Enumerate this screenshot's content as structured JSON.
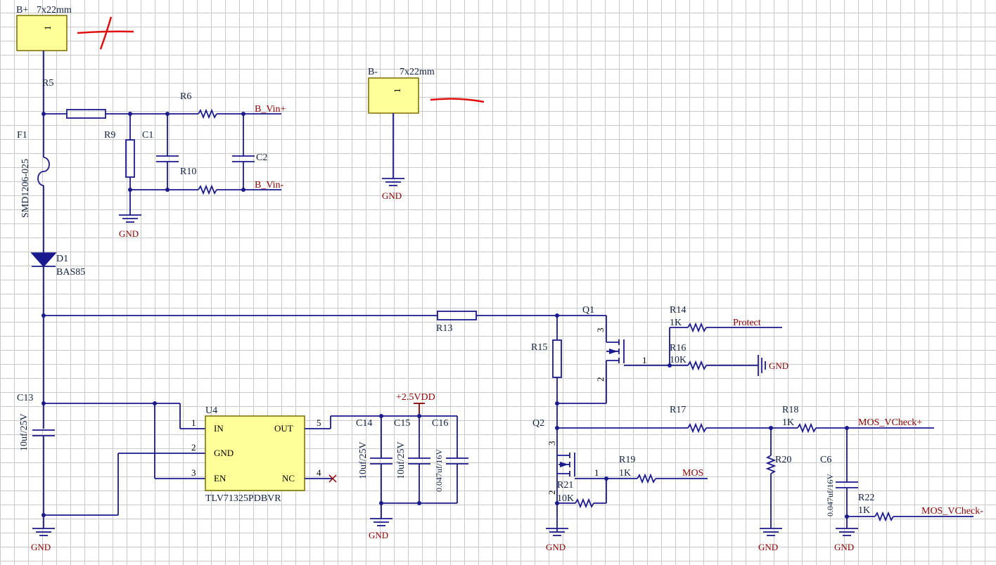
{
  "colors": {
    "wire": "#1a1a8c",
    "net": "#8b0000",
    "part_fill": "#ffff99",
    "annotation": "#e01010",
    "grid": "#c9c9c9"
  },
  "pads": {
    "bplus": {
      "ref": "B+",
      "size": "7x22mm",
      "pin": "1"
    },
    "bminus": {
      "ref": "B-",
      "size": "7x22mm",
      "pin": "1"
    }
  },
  "refs": {
    "r5": "R5",
    "f1": "F1",
    "f1_value": "SMD1206-025",
    "r6": "R6",
    "r9": "R9",
    "c1": "C1",
    "c2": "C2",
    "r10": "R10",
    "d1": "D1",
    "d1_value": "BAS85",
    "r13": "R13",
    "q1": "Q1",
    "r14": "R14",
    "r14_value": "1K",
    "r16": "R16",
    "r16_value": "10K",
    "r15": "R15",
    "c13": "C13",
    "c13_value": "10uf/25V",
    "u4": "U4",
    "u4_part": "TLV71325PDBVR",
    "c14": "C14",
    "c14_value": "10uf/25V",
    "c15": "C15",
    "c15_value": "10uf/25V",
    "c16": "C16",
    "c16_value": "0.047uf/16V",
    "q2": "Q2",
    "r17": "R17",
    "r18": "R18",
    "r18_value": "1K",
    "r19": "R19",
    "r19_value": "1K",
    "r20": "R20",
    "r21": "R21",
    "r21_value": "10K",
    "c6": "C6",
    "c6_value": "0.047uf/16V",
    "r22": "R22",
    "r22_value": "1K"
  },
  "nets": {
    "b_vin_plus": "B_Vin+",
    "b_vin_minus": "B_Vin-",
    "protect": "Protect",
    "gnd": "GND",
    "vdd": "+2.5VDD",
    "mos": "MOS",
    "vcheck_plus": "MOS_VCheck+",
    "vcheck_minus": "MOS_VCheck-"
  },
  "u4_pins": {
    "in": "IN",
    "gnd": "GND",
    "en": "EN",
    "out": "OUT",
    "nc": "NC",
    "n1": "1",
    "n2": "2",
    "n3": "3",
    "n4": "4",
    "n5": "5"
  },
  "q_pins": {
    "g": "1",
    "s": "2",
    "d": "3"
  },
  "annotations": [
    "plus-mark",
    "minus-mark"
  ]
}
